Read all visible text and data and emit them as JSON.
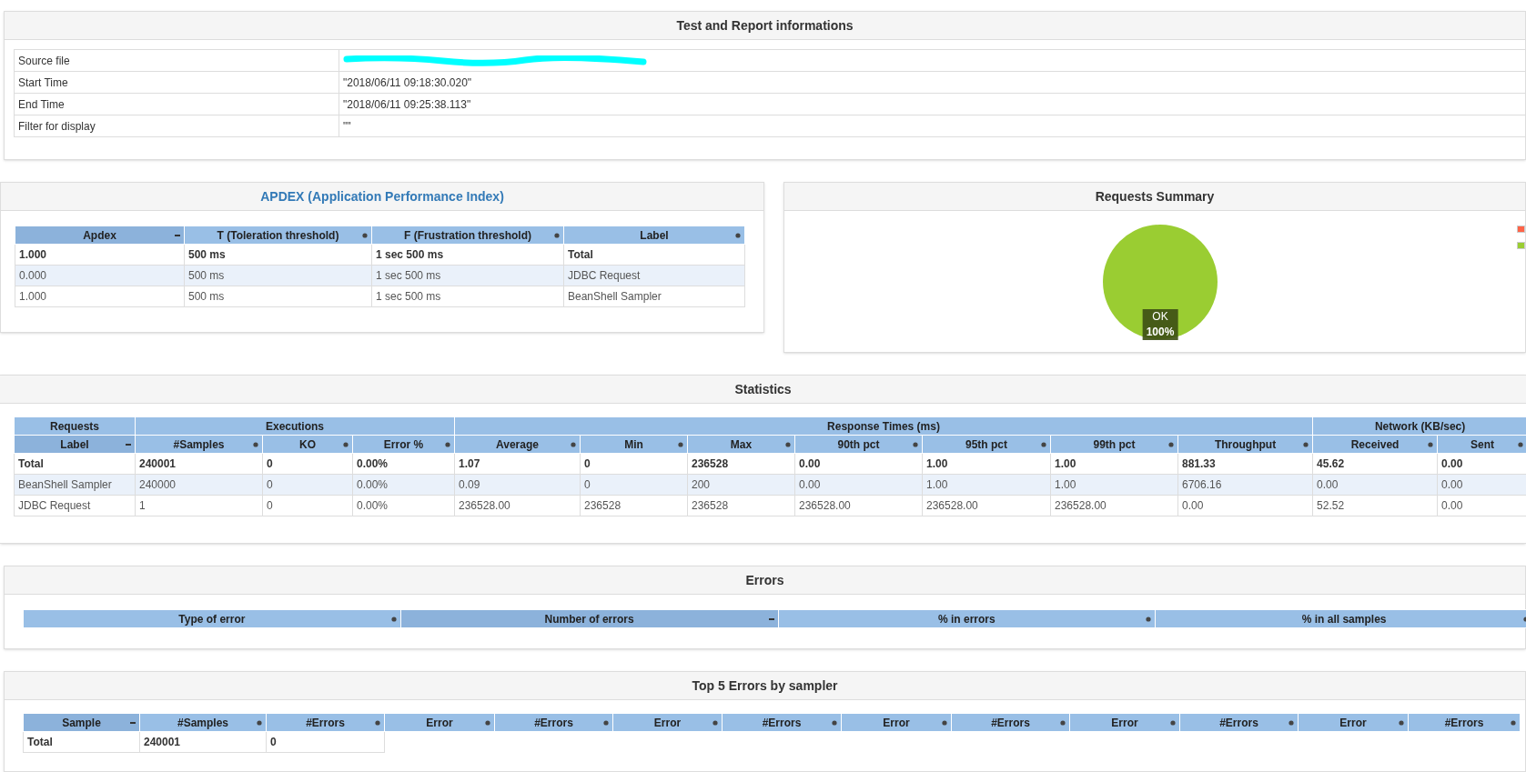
{
  "report_info": {
    "title": "Test and Report informations",
    "rows": [
      {
        "label": "Source file",
        "redacted": true
      },
      {
        "label": "Start Time",
        "redacted": false,
        "value": "\"2018/06/11 09:18:30.020\""
      },
      {
        "label": "End Time",
        "redacted": false,
        "value": "\"2018/06/11 09:25:38.113\""
      },
      {
        "label": "Filter for display",
        "redacted": false,
        "value": "\"\""
      }
    ]
  },
  "apdex": {
    "title": "APDEX (Application Performance Index)",
    "columns": [
      {
        "label": "Apdex",
        "sorted": true
      },
      {
        "label": "T (Toleration threshold)",
        "sorted": false
      },
      {
        "label": "F (Frustration threshold)",
        "sorted": false
      },
      {
        "label": "Label",
        "sorted": false
      }
    ],
    "rows": [
      {
        "kind": "total",
        "cells": [
          "1.000",
          "500 ms",
          "1 sec 500 ms",
          "Total"
        ]
      },
      {
        "kind": "item",
        "cells": [
          "0.000",
          "500 ms",
          "1 sec 500 ms",
          "JDBC Request"
        ]
      },
      {
        "kind": "item",
        "cells": [
          "1.000",
          "500 ms",
          "1 sec 500 ms",
          "BeanShell Sampler"
        ]
      }
    ]
  },
  "requests_summary": {
    "title": "Requests Summary",
    "chart_data": {
      "type": "pie",
      "categories": [
        "OK"
      ],
      "values": [
        100
      ],
      "value_labels": [
        "100%"
      ]
    },
    "legend": [
      {
        "color": "#ff6347"
      },
      {
        "color": "#9acd32"
      }
    ]
  },
  "statistics": {
    "title": "Statistics",
    "groups": [
      {
        "label": "Requests"
      },
      {
        "label": "Executions"
      },
      {
        "label": "Response Times (ms)"
      },
      {
        "label": "Network (KB/sec)"
      }
    ],
    "columns": [
      {
        "label": "Label",
        "sorted": true
      },
      {
        "label": "#Samples",
        "sorted": false
      },
      {
        "label": "KO",
        "sorted": false
      },
      {
        "label": "Error %",
        "sorted": false
      },
      {
        "label": "Average",
        "sorted": false
      },
      {
        "label": "Min",
        "sorted": false
      },
      {
        "label": "Max",
        "sorted": false
      },
      {
        "label": "90th pct",
        "sorted": false
      },
      {
        "label": "95th pct",
        "sorted": false
      },
      {
        "label": "99th pct",
        "sorted": false
      },
      {
        "label": "Throughput",
        "sorted": false
      },
      {
        "label": "Received",
        "sorted": false
      },
      {
        "label": "Sent",
        "sorted": false
      }
    ],
    "rows": [
      {
        "kind": "total",
        "cells": [
          "Total",
          "240001",
          "0",
          "0.00%",
          "1.07",
          "0",
          "236528",
          "0.00",
          "1.00",
          "1.00",
          "881.33",
          "45.62",
          "0.00"
        ]
      },
      {
        "kind": "item",
        "cells": [
          "BeanShell Sampler",
          "240000",
          "0",
          "0.00%",
          "0.09",
          "0",
          "200",
          "0.00",
          "1.00",
          "1.00",
          "6706.16",
          "0.00",
          "0.00"
        ]
      },
      {
        "kind": "item",
        "cells": [
          "JDBC Request",
          "1",
          "0",
          "0.00%",
          "236528.00",
          "236528",
          "236528",
          "236528.00",
          "236528.00",
          "236528.00",
          "0.00",
          "52.52",
          "0.00"
        ]
      }
    ]
  },
  "errors": {
    "title": "Errors",
    "columns": [
      {
        "label": "Type of error",
        "sorted": false
      },
      {
        "label": "Number of errors",
        "sorted": true
      },
      {
        "label": "% in errors",
        "sorted": false
      },
      {
        "label": "% in all samples",
        "sorted": false
      }
    ]
  },
  "top_errors": {
    "title": "Top 5 Errors by sampler",
    "columns": [
      {
        "label": "Sample",
        "sorted": true
      },
      {
        "label": "#Samples",
        "sorted": false
      },
      {
        "label": "#Errors",
        "sorted": false
      },
      {
        "label": "Error",
        "sorted": false
      },
      {
        "label": "#Errors",
        "sorted": false
      },
      {
        "label": "Error",
        "sorted": false
      },
      {
        "label": "#Errors",
        "sorted": false
      },
      {
        "label": "Error",
        "sorted": false
      },
      {
        "label": "#Errors",
        "sorted": false
      },
      {
        "label": "Error",
        "sorted": false
      },
      {
        "label": "#Errors",
        "sorted": false
      },
      {
        "label": "Error",
        "sorted": false
      },
      {
        "label": "#Errors",
        "sorted": false
      }
    ],
    "rows": [
      {
        "kind": "total",
        "cells": [
          "Total",
          "240001",
          "0"
        ]
      }
    ]
  }
}
